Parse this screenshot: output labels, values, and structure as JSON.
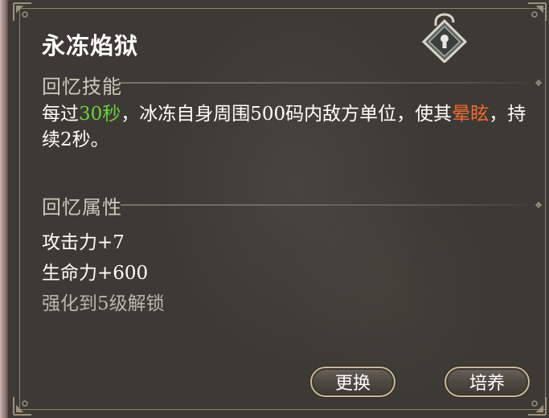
{
  "card": {
    "title": "永冻焰狱"
  },
  "skill_section": {
    "heading": "回忆技能",
    "desc_prefix": "每过",
    "desc_time": "30秒",
    "desc_middle": "，冰冻自身周围500码内敌方单位，使其",
    "desc_effect": "晕眩",
    "desc_suffix": "，持续2秒。"
  },
  "attr_section": {
    "heading": "回忆属性",
    "stats": [
      "攻击力+7",
      "生命力+600"
    ],
    "locked_text": "强化到5级解锁"
  },
  "buttons": {
    "replace": "更换",
    "upgrade": "培养"
  },
  "icons": {
    "lock": "unlock-icon"
  },
  "colors": {
    "highlight_time": "#6ccf3c",
    "highlight_effect": "#f06a32",
    "panel_bg": "#3d3a35",
    "frame": "#8d8272"
  }
}
